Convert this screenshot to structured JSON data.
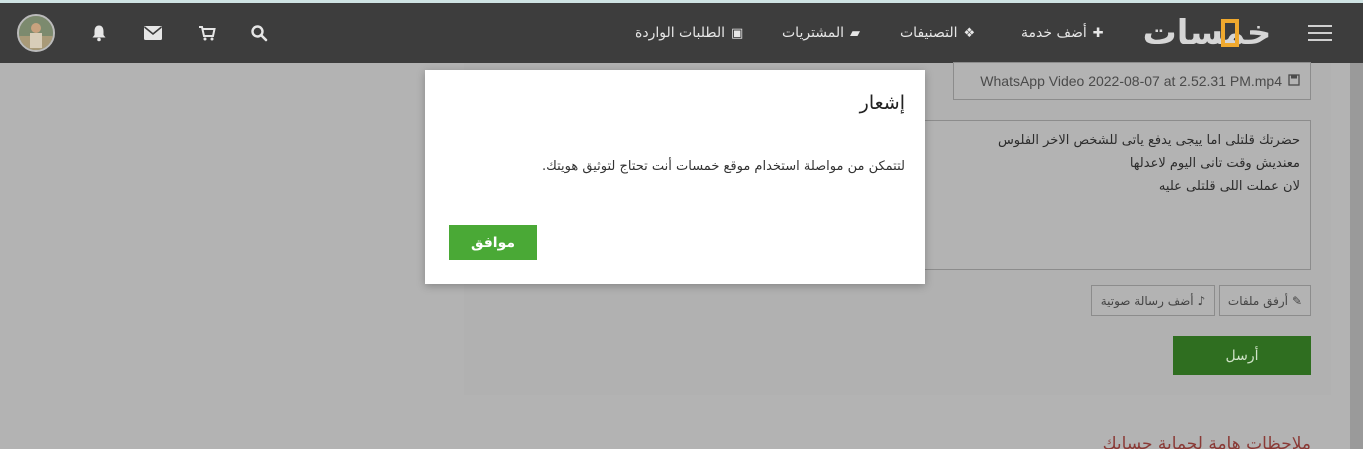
{
  "navbar": {
    "logo_text": "خمسات",
    "links": [
      {
        "label": "أضف خدمة",
        "icon": "plus-icon"
      },
      {
        "label": "التصنيفات",
        "icon": "cubes-icon"
      },
      {
        "label": "المشتريات",
        "icon": "folder-icon"
      },
      {
        "label": "الطلبات الواردة",
        "icon": "truck-icon"
      }
    ],
    "icons": [
      "search-icon",
      "cart-icon",
      "envelope-icon",
      "bell-icon",
      "avatar"
    ]
  },
  "page": {
    "file_name": "WhatsApp Video 2022-08-07 at 2.52.31 PM.mp4",
    "message_text": "حضرتك قلتلى اما ييجى يدفع ياتى للشخص الاخر الفلوس\nمعنديش وقت تانى اليوم لاعدلها\nلان عملت اللى قلتلى عليه",
    "attach_label": "أرفق ملفات",
    "voice_label": "أضف رسالة صوتية",
    "send_label": "أرسل",
    "notes_title": "ملاحظات هامة لحماية حسابك"
  },
  "modal": {
    "title": "إشعار",
    "body": "لتتمكن من مواصلة استخدام موقع خمسات أنت تحتاج لتوثيق هويتك.",
    "ok_label": "موافق"
  },
  "colors": {
    "navbar_bg": "#3d3d3d",
    "accent_green": "#4aa936",
    "logo_orange": "#f0a92e"
  }
}
